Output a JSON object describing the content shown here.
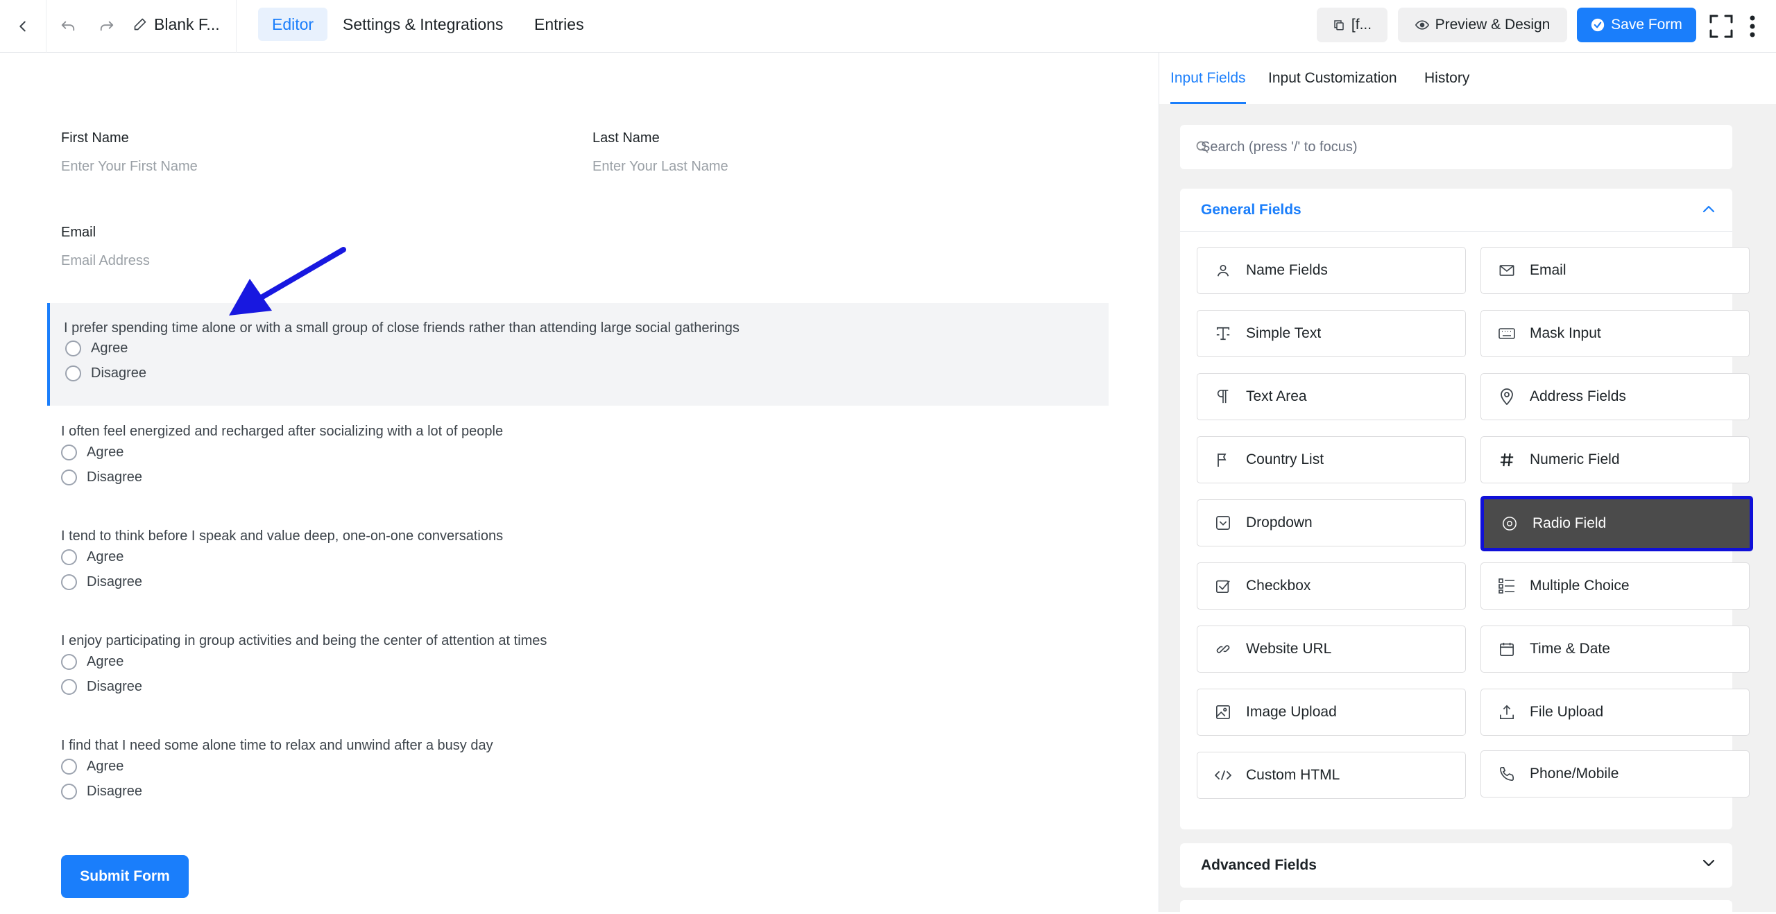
{
  "header": {
    "doc_title": "Blank F...",
    "tabs": [
      {
        "label": "Editor",
        "active": true
      },
      {
        "label": "Settings & Integrations",
        "active": false
      },
      {
        "label": "Entries",
        "active": false
      }
    ],
    "shortcode_label": "[f...",
    "preview_label": "Preview & Design",
    "save_label": "Save Form"
  },
  "form": {
    "first_name": {
      "label": "First Name",
      "placeholder": "Enter Your First Name"
    },
    "last_name": {
      "label": "Last Name",
      "placeholder": "Enter Your Last Name"
    },
    "email": {
      "label": "Email",
      "placeholder": "Email Address"
    },
    "questions": [
      {
        "text": "I prefer spending time alone or with a small group of close friends rather than attending large social gatherings",
        "options": [
          "Agree",
          "Disagree"
        ]
      },
      {
        "text": "I often feel energized and recharged after socializing with a lot of people",
        "options": [
          "Agree",
          "Disagree"
        ]
      },
      {
        "text": "I tend to think before I speak and value deep, one-on-one conversations",
        "options": [
          "Agree",
          "Disagree"
        ]
      },
      {
        "text": "I enjoy participating in group activities and being the center of attention at times",
        "options": [
          "Agree",
          "Disagree"
        ]
      },
      {
        "text": "I find that I need some alone time to relax and unwind after a busy day",
        "options": [
          "Agree",
          "Disagree"
        ]
      }
    ],
    "submit_label": "Submit Form"
  },
  "sidebar": {
    "tabs": [
      {
        "label": "Input Fields",
        "active": true
      },
      {
        "label": "Input Customization",
        "active": false
      },
      {
        "label": "History",
        "active": false
      }
    ],
    "search_placeholder": "Search (press '/' to focus)",
    "general_title": "General Fields",
    "fields": [
      {
        "label": "Name Fields",
        "icon": "user-icon"
      },
      {
        "label": "Email",
        "icon": "envelope-icon"
      },
      {
        "label": "Simple Text",
        "icon": "text-cursor-icon"
      },
      {
        "label": "Mask Input",
        "icon": "keyboard-icon"
      },
      {
        "label": "Text Area",
        "icon": "paragraph-icon"
      },
      {
        "label": "Address Fields",
        "icon": "map-pin-icon"
      },
      {
        "label": "Country List",
        "icon": "flag-icon"
      },
      {
        "label": "Numeric Field",
        "icon": "hash-icon"
      },
      {
        "label": "Dropdown",
        "icon": "dropdown-icon"
      },
      {
        "label": "Radio Field",
        "icon": "radio-icon"
      },
      {
        "label": "Checkbox",
        "icon": "checkbox-icon"
      },
      {
        "label": "Multiple Choice",
        "icon": "list-icon"
      },
      {
        "label": "Website URL",
        "icon": "link-icon"
      },
      {
        "label": "Time & Date",
        "icon": "calendar-icon"
      },
      {
        "label": "Image Upload",
        "icon": "image-icon"
      },
      {
        "label": "File Upload",
        "icon": "upload-icon"
      },
      {
        "label": "Custom HTML",
        "icon": "code-icon"
      },
      {
        "label": "Phone/Mobile",
        "icon": "phone-icon"
      }
    ],
    "advanced_title": "Advanced Fields"
  },
  "colors": {
    "accent": "#1a7efb",
    "highlight_bg": "#4b4b4b",
    "highlight_border": "#1010d8",
    "arrow": "#1818e0"
  }
}
